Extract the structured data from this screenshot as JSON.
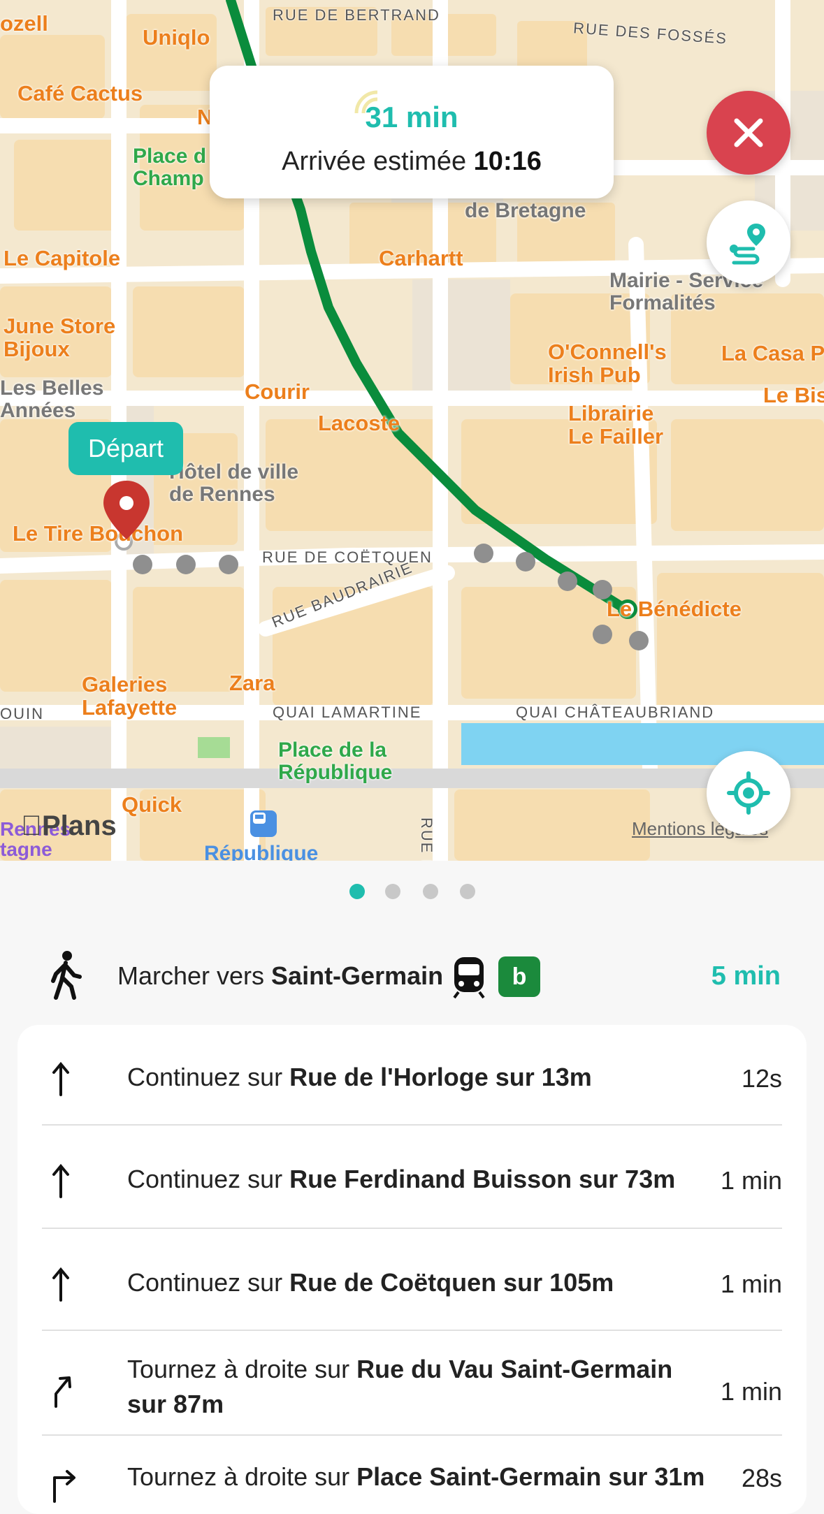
{
  "map": {
    "pois_orange": [
      "ozell",
      "Uniqlo",
      "Café Cactus",
      "N",
      "Le Capitole",
      "Carhartt",
      "June Store\nBijoux",
      "Courir",
      "Lacoste",
      "O'Connell's\nIrish Pub",
      "La Casa P",
      "Le Bis",
      "Librairie\nLe Failler",
      "Le Tire Bouchon",
      "Le Bénédicte",
      "Galeries\nLafayette",
      "Zara",
      "Quick"
    ],
    "pois_green": [
      "Place d\nChamp",
      "Place de la\nRépublique"
    ],
    "pois_gray": [
      "de Bretagne",
      "Mairie - Service\nFormalités",
      "Les Belles\nAnnées",
      "Hôtel de ville\nde Rennes",
      "Rennes\ntagne"
    ],
    "streets": [
      "RUE DE BERTRAND",
      "RUE DES FOSSÉS",
      "RUE DE COËTQUEN",
      "RUE BAUDRAIRIE",
      "QUAI LAMARTINE",
      "QUAI CHÂTEAUBRIAND",
      "OUIN",
      "RUE D"
    ],
    "metro_station": "République",
    "depart_label": "Départ",
    "logo": "Plans",
    "legal": "Mentions légales"
  },
  "eta": {
    "duration": "31 min",
    "arrival_label": "Arrivée estimée",
    "arrival_time": "10:16"
  },
  "buttons": {
    "close_icon": "close-icon",
    "itinerary_icon": "route-pin-icon",
    "locate_icon": "locate-icon"
  },
  "pager": {
    "count": 4,
    "active": 0
  },
  "walk": {
    "prefix": "Marcher vers ",
    "destination": "Saint-Germain",
    "line": "b",
    "duration": "5 min"
  },
  "steps": [
    {
      "arrow": "straight",
      "prefix": "Continuez sur ",
      "bold": "Rue de l'Horloge sur 13m",
      "duration": "12s"
    },
    {
      "arrow": "straight",
      "prefix": "Continuez sur ",
      "bold": "Rue Ferdinand Buisson sur 73m",
      "duration": "1 min"
    },
    {
      "arrow": "straight",
      "prefix": "Continuez sur ",
      "bold": "Rue de Coëtquen sur 105m",
      "duration": "1 min"
    },
    {
      "arrow": "slight-right",
      "prefix": "Tournez à droite sur ",
      "bold": "Rue du Vau Saint-Germain",
      "bold2": "sur 87m",
      "duration": "1 min"
    },
    {
      "arrow": "right",
      "prefix": "Tournez à droite sur ",
      "bold": "Place Saint-Germain sur 31m",
      "duration": "28s"
    }
  ],
  "colors": {
    "accent": "#1fbdae",
    "route": "#0a8c3c",
    "close": "#d9434f",
    "line_b": "#1b8a3c"
  }
}
